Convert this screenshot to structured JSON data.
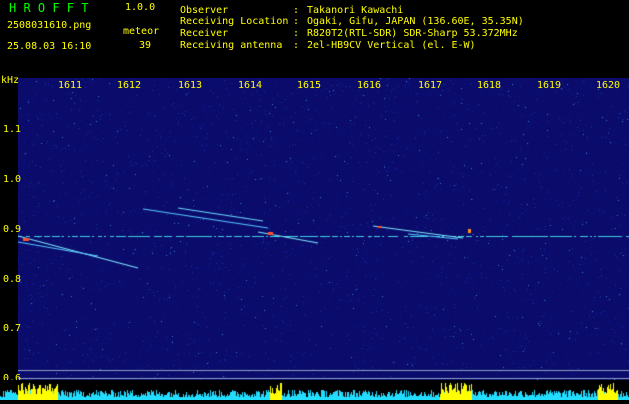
{
  "app": {
    "title": "H R O F F T",
    "version": "1.0.0"
  },
  "file": {
    "name": "2508031610.png",
    "datetime": "25.08.03 16:10"
  },
  "meteor": {
    "label": "meteor",
    "count": "39"
  },
  "info": [
    {
      "label": "Observer",
      "sep": ":",
      "value": "Takanori Kawachi"
    },
    {
      "label": "Receiving Location",
      "sep": ":",
      "value": "Ogaki, Gifu, JAPAN (136.60E, 35.35N)"
    },
    {
      "label": "Receiver",
      "sep": ":",
      "value": "R820T2(RTL-SDR) SDR-Sharp 53.372MHz"
    },
    {
      "label": "Receiving antenna",
      "sep": ":",
      "value": "2el-HB9CV Vertical (el. E-W)"
    }
  ],
  "axes": {
    "y_unit": "kHz",
    "x_ticks": [
      "1611",
      "1612",
      "1613",
      "1614",
      "1615",
      "1616",
      "1617",
      "1618",
      "1619",
      "1620"
    ],
    "y_ticks": [
      "1.1",
      "1.0",
      "0.9",
      "0.8",
      "0.7",
      "0.6"
    ]
  },
  "colors": {
    "text": "#ffff00",
    "title": "#00ff00",
    "background": "#000000",
    "noise": "#0a0b6a",
    "level": "#22ddff",
    "peak": "#ffff00"
  }
}
